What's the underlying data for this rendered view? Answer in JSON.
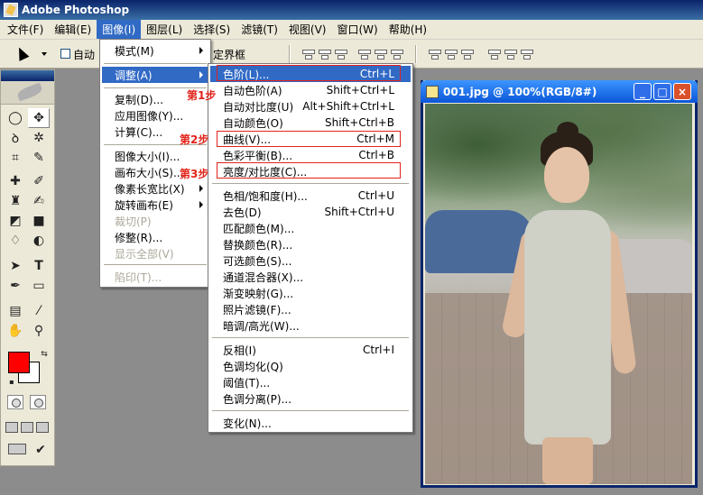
{
  "window": {
    "title": "Adobe Photoshop"
  },
  "menubar": [
    {
      "label": "文件(F)"
    },
    {
      "label": "编辑(E)"
    },
    {
      "label": "图像(I)",
      "active": true
    },
    {
      "label": "图层(L)"
    },
    {
      "label": "选择(S)"
    },
    {
      "label": "滤镜(T)"
    },
    {
      "label": "视图(V)"
    },
    {
      "label": "窗口(W)"
    },
    {
      "label": "帮助(H)"
    }
  ],
  "options": {
    "auto_label": "自动",
    "bounding_label": "定界框"
  },
  "image_menu": {
    "items": [
      {
        "label": "模式(M)",
        "submenu": true
      },
      {
        "label": "调整(A)",
        "submenu": true,
        "highlight": true
      },
      {
        "label": "复制(D)..."
      },
      {
        "label": "应用图像(Y)..."
      },
      {
        "label": "计算(C)..."
      },
      {
        "label": "图像大小(I)..."
      },
      {
        "label": "画布大小(S)..."
      },
      {
        "label": "像素长宽比(X)",
        "submenu": true
      },
      {
        "label": "旋转画布(E)",
        "submenu": true
      },
      {
        "label": "裁切(P)",
        "disabled": true
      },
      {
        "label": "修整(R)..."
      },
      {
        "label": "显示全部(V)",
        "disabled": true
      },
      {
        "label": "陷印(T)...",
        "disabled": true
      }
    ]
  },
  "adjust_menu": {
    "items": [
      {
        "label": "色阶(L)...",
        "shortcut": "Ctrl+L",
        "highlight": true
      },
      {
        "label": "自动色阶(A)",
        "shortcut": "Shift+Ctrl+L"
      },
      {
        "label": "自动对比度(U)",
        "shortcut": "Alt+Shift+Ctrl+L"
      },
      {
        "label": "自动颜色(O)",
        "shortcut": "Shift+Ctrl+B"
      },
      {
        "label": "曲线(V)...",
        "shortcut": "Ctrl+M"
      },
      {
        "label": "色彩平衡(B)...",
        "shortcut": "Ctrl+B"
      },
      {
        "label": "亮度/对比度(C)...",
        "shortcut": ""
      },
      {
        "label": "色相/饱和度(H)...",
        "shortcut": "Ctrl+U"
      },
      {
        "label": "去色(D)",
        "shortcut": "Shift+Ctrl+U"
      },
      {
        "label": "匹配颜色(M)...",
        "shortcut": ""
      },
      {
        "label": "替换颜色(R)...",
        "shortcut": ""
      },
      {
        "label": "可选颜色(S)...",
        "shortcut": ""
      },
      {
        "label": "通道混合器(X)...",
        "shortcut": ""
      },
      {
        "label": "渐变映射(G)...",
        "shortcut": ""
      },
      {
        "label": "照片滤镜(F)...",
        "shortcut": ""
      },
      {
        "label": "暗调/高光(W)...",
        "shortcut": ""
      },
      {
        "label": "反相(I)",
        "shortcut": "Ctrl+I"
      },
      {
        "label": "色调均化(Q)",
        "shortcut": ""
      },
      {
        "label": "阈值(T)...",
        "shortcut": ""
      },
      {
        "label": "色调分离(P)...",
        "shortcut": ""
      },
      {
        "label": "变化(N)...",
        "shortcut": ""
      }
    ]
  },
  "annotations": {
    "step1": "第1步",
    "step2": "第2步",
    "step3": "第3步"
  },
  "document": {
    "title": "001.jpg @ 100%(RGB/8#)",
    "min": "_",
    "max": "□",
    "close": "×"
  },
  "colors": {
    "foreground": "#ff0000",
    "background": "#ffffff",
    "annotation": "#e2231a",
    "highlight": "#316ac5"
  }
}
